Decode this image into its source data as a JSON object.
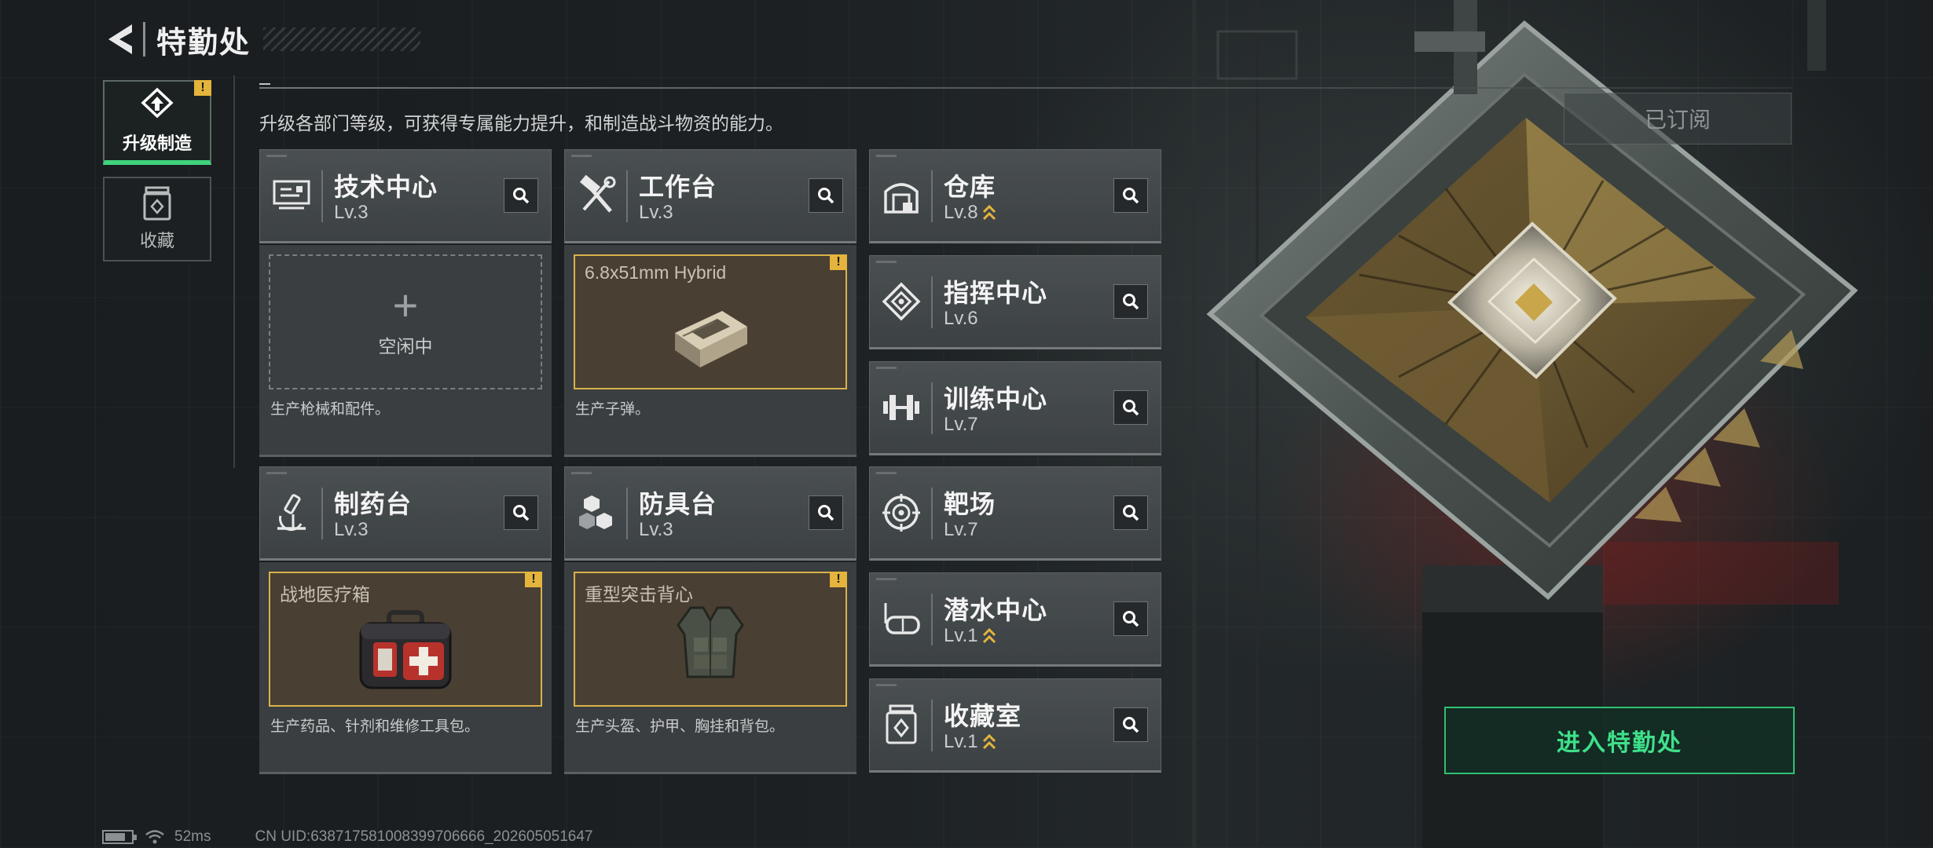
{
  "header": {
    "title": "特勤处"
  },
  "side_tabs": [
    {
      "label": "升级制造",
      "active": true,
      "alert": "!"
    },
    {
      "label": "收藏",
      "active": false
    }
  ],
  "description": "升级各部门等级，可获得专属能力提升，和制造战斗物资的能力。",
  "subscribed_label": "已订阅",
  "departments": {
    "tech": {
      "name": "技术中心",
      "level": "Lv.3",
      "icon": "circuit-board-icon"
    },
    "workbench": {
      "name": "工作台",
      "level": "Lv.3",
      "icon": "hammer-wrench-icon"
    },
    "warehouse": {
      "name": "仓库",
      "level": "Lv.8",
      "icon": "warehouse-icon",
      "upgradable": true
    },
    "command": {
      "name": "指挥中心",
      "level": "Lv.6",
      "icon": "command-chip-icon"
    },
    "training": {
      "name": "训练中心",
      "level": "Lv.7",
      "icon": "dumbbell-icon"
    },
    "pharmacy": {
      "name": "制药台",
      "level": "Lv.3",
      "icon": "microscope-icon"
    },
    "armor": {
      "name": "防具台",
      "level": "Lv.3",
      "icon": "armor-blocks-icon"
    },
    "range": {
      "name": "靶场",
      "level": "Lv.7",
      "icon": "target-icon"
    },
    "diving": {
      "name": "潜水中心",
      "level": "Lv.1",
      "icon": "diving-mask-icon",
      "upgradable": true
    },
    "collection": {
      "name": "收藏室",
      "level": "Lv.1",
      "icon": "collection-jar-icon",
      "upgradable": true
    }
  },
  "panels": {
    "tech": {
      "slot_state": "empty",
      "slot_text": "空闲中",
      "desc": "生产枪械和配件。"
    },
    "workbench": {
      "item_name": "6.8x51mm Hybrid",
      "item_icon": "ammo-box-icon",
      "alert": "!",
      "desc": "生产子弹。"
    },
    "pharmacy": {
      "item_name": "战地医疗箱",
      "item_icon": "medical-kit-icon",
      "alert": "!",
      "desc": "生产药品、针剂和维修工具包。"
    },
    "armor": {
      "item_name": "重型突击背心",
      "item_icon": "tactical-vest-icon",
      "alert": "!",
      "desc": "生产头盔、护甲、胸挂和背包。"
    }
  },
  "enter_button": "进入特勤处",
  "footer": {
    "ping": "52ms",
    "uid": "CN UID:638717581008399706666_202605051647"
  },
  "colors": {
    "accent_green": "#3fe08a",
    "alert_yellow": "#e4b43c",
    "item_border": "#d9b24a"
  }
}
